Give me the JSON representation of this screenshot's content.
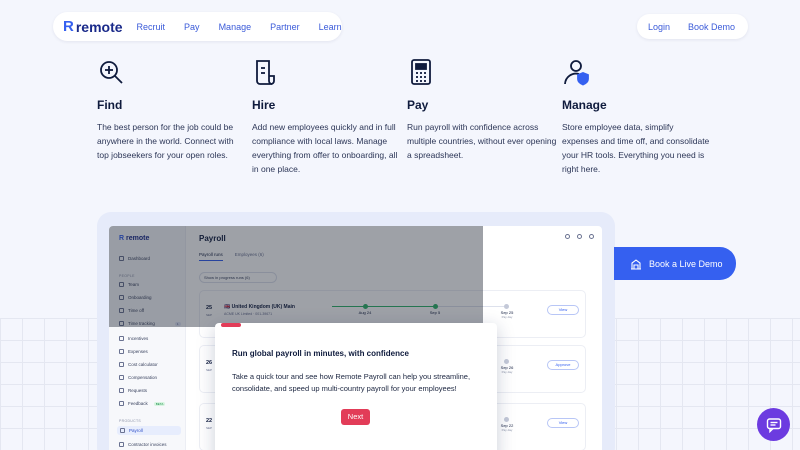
{
  "nav": {
    "logo": "remote",
    "links": [
      "Recruit",
      "Pay",
      "Manage",
      "Partner",
      "Learn"
    ],
    "login": "Login",
    "book_demo": "Book Demo"
  },
  "features": [
    {
      "title": "Find",
      "desc": "The best person for the job could be anywhere in the world. Connect with top jobseekers for your open roles.",
      "icon": "search-plus-icon"
    },
    {
      "title": "Hire",
      "desc": "Add new employees quickly and in full compliance with local laws. Manage everything from offer to onboarding, all in one place.",
      "icon": "document-icon"
    },
    {
      "title": "Pay",
      "desc": "Run payroll with confidence across multiple countries, without ever opening a spreadsheet.",
      "icon": "calculator-icon"
    },
    {
      "title": "Manage",
      "desc": "Store employee data, simplify expenses and time off, and consolidate your HR tools. Everything you need is right here.",
      "icon": "user-shield-icon"
    }
  ],
  "app": {
    "logo": "remote",
    "dashboard": "Dashboard",
    "section_people": "PEOPLE",
    "section_products": "PRODUCTS",
    "sidebar": [
      "Team",
      "Onboarding",
      "Time off",
      "Time tracking",
      "Incentives",
      "Expenses",
      "Cost calculator",
      "Compensation",
      "Requests",
      "Feedback",
      "Payroll",
      "Contractor invoices"
    ],
    "feedback_badge": "BETA",
    "time_tracking_count": "1",
    "title": "Payroll",
    "tabs": [
      "Payroll runs",
      "Employees (6)"
    ],
    "filter": "Show in progress runs (6)",
    "runs": [
      {
        "day": "25",
        "month": "SEP",
        "name": "United Kingdom (UK) Main",
        "sub": "ACME UK Limited · 001-39671",
        "t1": "Aug 24",
        "t2": "Sep 5",
        "t3": "Sep 25",
        "t3_sub": "Pay day",
        "btn": "View"
      },
      {
        "day": "26",
        "month": "SEP",
        "btn": "Approve",
        "t3": "Sep 26",
        "t3_sub": "Pay day"
      },
      {
        "day": "22",
        "month": "SEP",
        "btn": "View",
        "t3": "Sep 22",
        "t3_sub": "Pay day"
      }
    ]
  },
  "modal": {
    "title": "Run global payroll in minutes, with confidence",
    "body": "Take a quick tour and see how Remote Payroll can help you streamline, consolidate, and speed up multi-country payroll for your employees!",
    "next": "Next"
  },
  "cta": {
    "label": "Book a Live Demo"
  },
  "colors": {
    "brand": "#3560f0",
    "accent_red": "#e23c58",
    "chat_purple": "#6c3be0",
    "dark_text": "#0f1b3d"
  }
}
